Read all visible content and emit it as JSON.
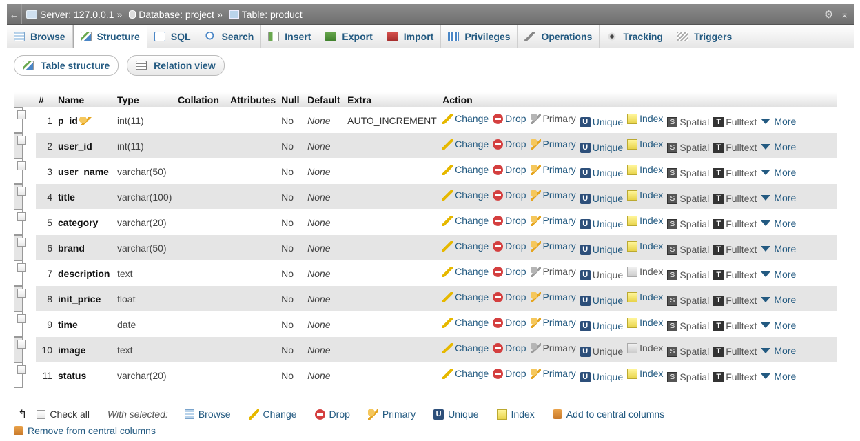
{
  "breadcrumb": {
    "server_label": "Server: 127.0.0.1",
    "database_label": "Database: project",
    "table_label": "Table: product",
    "separator": "»"
  },
  "tabs": [
    {
      "label": "Browse",
      "icon": "browse-icon",
      "active": false
    },
    {
      "label": "Structure",
      "icon": "structure-icon",
      "active": true
    },
    {
      "label": "SQL",
      "icon": "sql-icon",
      "active": false
    },
    {
      "label": "Search",
      "icon": "search-icon",
      "active": false
    },
    {
      "label": "Insert",
      "icon": "insert-icon",
      "active": false
    },
    {
      "label": "Export",
      "icon": "export-icon",
      "active": false
    },
    {
      "label": "Import",
      "icon": "import-icon",
      "active": false
    },
    {
      "label": "Privileges",
      "icon": "privileges-icon",
      "active": false
    },
    {
      "label": "Operations",
      "icon": "wrench-icon",
      "active": false
    },
    {
      "label": "Tracking",
      "icon": "eye-icon",
      "active": false
    },
    {
      "label": "Triggers",
      "icon": "triggers-icon",
      "active": false
    }
  ],
  "subtabs": [
    {
      "label": "Table structure",
      "active": true
    },
    {
      "label": "Relation view",
      "active": false
    }
  ],
  "columns": [
    "#",
    "Name",
    "Type",
    "Collation",
    "Attributes",
    "Null",
    "Default",
    "Extra",
    "Action"
  ],
  "actions": {
    "change": "Change",
    "drop": "Drop",
    "primary": "Primary",
    "unique": "Unique",
    "index": "Index",
    "spatial": "Spatial",
    "fulltext": "Fulltext",
    "more": "More"
  },
  "rows": [
    {
      "num": "1",
      "name": "p_id",
      "type": "int(11)",
      "collation": "",
      "attributes": "",
      "null": "No",
      "default": "None",
      "extra": "AUTO_INCREMENT",
      "is_primary": true
    },
    {
      "num": "2",
      "name": "user_id",
      "type": "int(11)",
      "collation": "",
      "attributes": "",
      "null": "No",
      "default": "None",
      "extra": "",
      "is_primary": false
    },
    {
      "num": "3",
      "name": "user_name",
      "type": "varchar(50)",
      "collation": "",
      "attributes": "",
      "null": "No",
      "default": "None",
      "extra": "",
      "is_primary": false
    },
    {
      "num": "4",
      "name": "title",
      "type": "varchar(100)",
      "collation": "",
      "attributes": "",
      "null": "No",
      "default": "None",
      "extra": "",
      "is_primary": false
    },
    {
      "num": "5",
      "name": "category",
      "type": "varchar(20)",
      "collation": "",
      "attributes": "",
      "null": "No",
      "default": "None",
      "extra": "",
      "is_primary": false
    },
    {
      "num": "6",
      "name": "brand",
      "type": "varchar(50)",
      "collation": "",
      "attributes": "",
      "null": "No",
      "default": "None",
      "extra": "",
      "is_primary": false
    },
    {
      "num": "7",
      "name": "description",
      "type": "text",
      "collation": "",
      "attributes": "",
      "null": "No",
      "default": "None",
      "extra": "",
      "is_primary": false,
      "text_type": true
    },
    {
      "num": "8",
      "name": "init_price",
      "type": "float",
      "collation": "",
      "attributes": "",
      "null": "No",
      "default": "None",
      "extra": "",
      "is_primary": false
    },
    {
      "num": "9",
      "name": "time",
      "type": "date",
      "collation": "",
      "attributes": "",
      "null": "No",
      "default": "None",
      "extra": "",
      "is_primary": false
    },
    {
      "num": "10",
      "name": "image",
      "type": "text",
      "collation": "",
      "attributes": "",
      "null": "No",
      "default": "None",
      "extra": "",
      "is_primary": false,
      "text_type": true
    },
    {
      "num": "11",
      "name": "status",
      "type": "varchar(20)",
      "collation": "",
      "attributes": "",
      "null": "No",
      "default": "None",
      "extra": "",
      "is_primary": false
    }
  ],
  "footer": {
    "check_all": "Check all",
    "with_selected": "With selected:",
    "browse": "Browse",
    "change": "Change",
    "drop": "Drop",
    "primary": "Primary",
    "unique": "Unique",
    "index": "Index",
    "add_central": "Add to central columns",
    "remove_central": "Remove from central columns"
  },
  "colors": {
    "link": "#235a81",
    "row_alt": "#e5e5e5",
    "breadcrumb_bg": "#7d7d7d"
  }
}
